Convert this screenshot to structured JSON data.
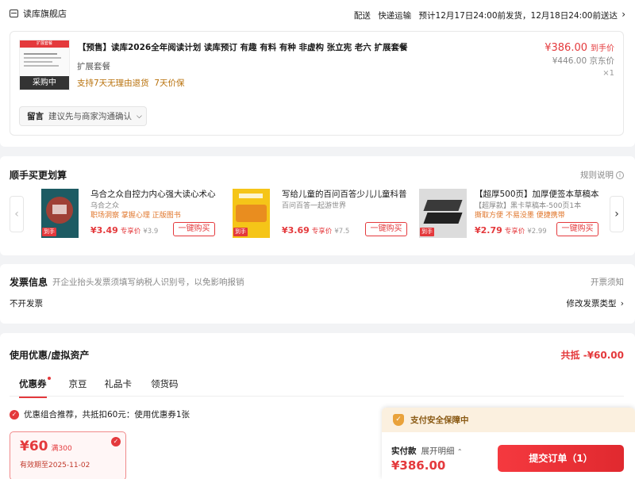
{
  "shop": {
    "name": "读库旗舰店",
    "delivery_label": "配送",
    "delivery_method": "快递运输",
    "delivery_eta": "预计12月17日24:00前发货，12月18日24:00前送达",
    "chevron": "chevron-right"
  },
  "product": {
    "thumb_header": "扩展套餐",
    "thumb_badge": "采购中",
    "title": "【预售】读库2026全年阅读计划 读库预订 有趣 有料 有种 非虚构 张立宪 老六 扩展套餐",
    "spec": "扩展套餐",
    "service": "支持7天无理由退货  7天价保",
    "price": "¥386.00",
    "price_note": "到手价",
    "jd_price": "¥446.00",
    "jd_price_note": "京东价",
    "qty": "×1"
  },
  "remark": {
    "label": "留言",
    "hint": "建议先与商家沟通确认"
  },
  "addon": {
    "title": "顺手买更划算",
    "rules": "规则说明",
    "items": [
      {
        "name": "乌合之众自控力内心强大读心术心",
        "sub": "乌合之众",
        "tag": "职场洞察 掌握心理 正版图书",
        "price": "¥3.49",
        "price_note": "专享价",
        "orig": "¥3.9",
        "btn": "一键购买",
        "cover": "#1d5b63",
        "cover2": "#c0392b"
      },
      {
        "name": "写给儿童的百问百答少儿儿童科普",
        "sub": "百问百答一起游世界",
        "tag": "",
        "price": "¥3.69",
        "price_note": "专享价",
        "orig": "¥7.5",
        "btn": "一键购买",
        "cover": "#f5c518",
        "cover2": "#e67e22"
      },
      {
        "name": "【超厚500页】加厚便签本草稿本",
        "sub": "【超厚款】黑卡草稿本-500页1本",
        "tag": "撕取方便 不易没墨 便捷携带",
        "price": "¥2.79",
        "price_note": "专享价",
        "orig": "¥2.99",
        "btn": "一键购买",
        "cover": "#3a3a3a",
        "cover2": "#dcdcdc"
      }
    ]
  },
  "invoice": {
    "title": "发票信息",
    "hint": "开企业抬头发票须填写纳税人识别号，以免影响报销",
    "notice": "开票须知",
    "type": "不开发票",
    "modify": "修改发票类型"
  },
  "coupon": {
    "title": "使用优惠/虚拟资产",
    "total": "共抵 -¥60.00",
    "tabs": [
      "优惠券",
      "京豆",
      "礼品卡",
      "领货码"
    ],
    "recommend": "优惠组合推荐，共抵扣60元：使用优惠券1张",
    "card_amount": "¥60",
    "card_cond": "满300",
    "card_expiry": "有效期至2025-11-02"
  },
  "pay": {
    "banner": "支付安全保障中",
    "label": "实付款",
    "detail": "展开明细",
    "amount": "¥386.00",
    "submit": "提交订单（1）"
  },
  "colors": {
    "accent": "#e4393c",
    "page_bg": "#f2f3f5",
    "gold": "#b8700a"
  }
}
